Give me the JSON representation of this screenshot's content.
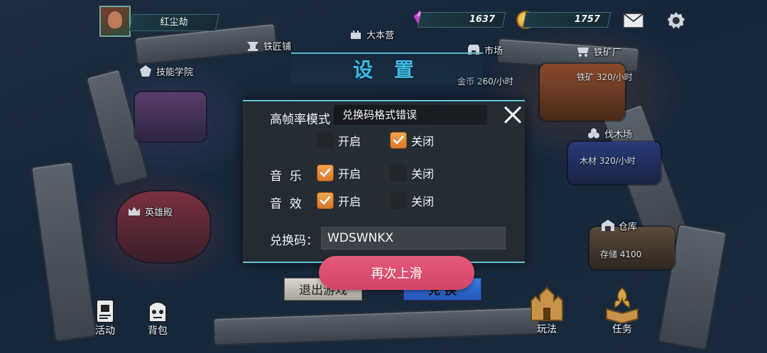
{
  "hud": {
    "player_name": "红尘劫",
    "gems": "1637",
    "coins": "1757"
  },
  "map": {
    "hq": "大本营",
    "blacksmith": "铁匠铺",
    "skill_academy": "技能学院",
    "market": "市场",
    "market_rate": "金币 260/小时",
    "iron_mine": "铁矿厂",
    "iron_rate": "铁矿 320/小时",
    "lumber_yard": "伐木场",
    "lumber_rate": "木材 320/小时",
    "hero_hall": "英雄殿",
    "warehouse": "仓库",
    "warehouse_storage": "存储 4100"
  },
  "settings": {
    "title": "设 置",
    "high_frame_label": "高帧率模式",
    "toast": "兑换码格式错误",
    "high_frame_on": "开启",
    "high_frame_off": "关闭",
    "music_label": "音  乐",
    "music_on": "开启",
    "music_off": "关闭",
    "sfx_label": "音  效",
    "sfx_on": "开启",
    "sfx_off": "关闭",
    "code_label": "兑换码：",
    "code_value": "WDSWNKX",
    "swipe_label": "再次上滑",
    "exit_label": "退出游戏",
    "redeem_label": "兑 换"
  },
  "bottom": {
    "activity": "活动",
    "backpack": "背包",
    "gameplay": "玩法",
    "tasks": "任务"
  },
  "colors": {
    "accent": "#5fc6d8",
    "checkbox_on": "#e58a36",
    "swipe_button": "#d94d6e",
    "redeem_button": "#2f6ad0"
  },
  "states": {
    "high_frame": "off",
    "music": "on",
    "sfx": "on"
  }
}
